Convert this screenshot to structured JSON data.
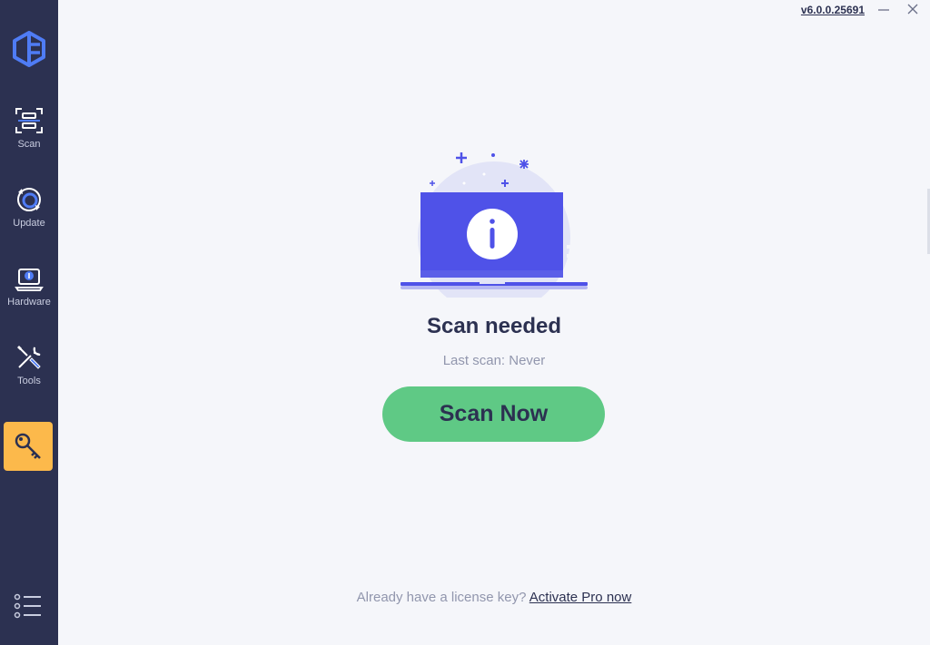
{
  "window": {
    "version": "v6.0.0.25691"
  },
  "sidebar": {
    "items": [
      {
        "id": "scan",
        "label": "Scan",
        "icon": "scan-icon"
      },
      {
        "id": "update",
        "label": "Update",
        "icon": "update-icon"
      },
      {
        "id": "hardware",
        "label": "Hardware",
        "icon": "hardware-icon"
      },
      {
        "id": "tools",
        "label": "Tools",
        "icon": "tools-icon"
      },
      {
        "id": "license",
        "label": "",
        "icon": "key-icon"
      }
    ],
    "active_color": "#fcb94b",
    "background": "#2c3151"
  },
  "main": {
    "status_title": "Scan needed",
    "last_scan": "Last scan: Never",
    "scan_button": "Scan Now",
    "license_prompt": "Already have a license key?",
    "activate_link": "Activate Pro now"
  },
  "colors": {
    "accent": "#4f52e8",
    "button_green": "#5fc985",
    "text_dark": "#2c3151",
    "text_muted": "#9196ad"
  }
}
